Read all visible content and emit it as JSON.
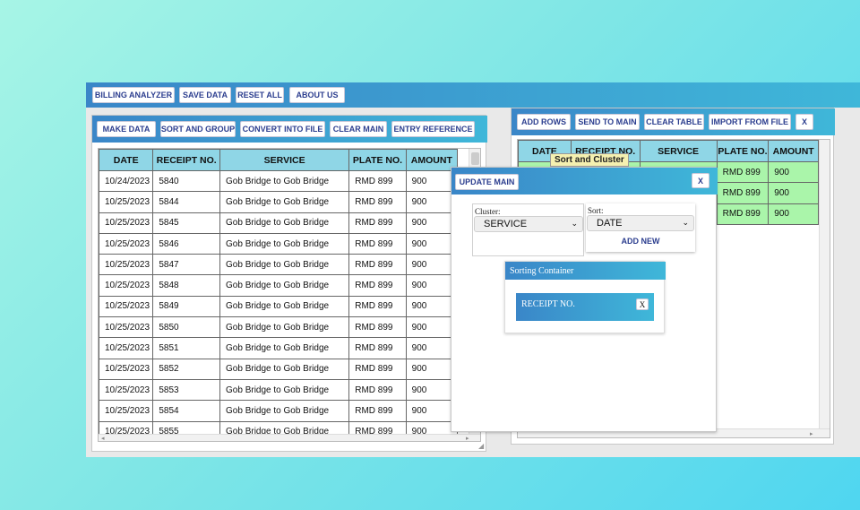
{
  "topbar": {
    "billing_analyzer": "BILLING ANALYZER",
    "save_data": "SAVE DATA",
    "reset_all": "RESET ALL",
    "about_us": "ABOUT US"
  },
  "main_toolbar": {
    "make_data": "MAKE DATA",
    "sort_and_group": "SORT AND GROUP",
    "convert_into_file": "CONVERT INTO FILE",
    "clear_main": "CLEAR MAIN",
    "entry_reference": "ENTRY REFERENCE"
  },
  "main_table": {
    "headers": [
      "DATE",
      "RECEIPT NO.",
      "SERVICE",
      "PLATE NO.",
      "AMOUNT"
    ],
    "rows": [
      [
        "10/24/2023",
        "5840",
        "Gob Bridge to Gob Bridge",
        "RMD 899",
        "900"
      ],
      [
        "10/25/2023",
        "5844",
        "Gob Bridge to Gob Bridge",
        "RMD 899",
        "900"
      ],
      [
        "10/25/2023",
        "5845",
        "Gob Bridge to Gob Bridge",
        "RMD 899",
        "900"
      ],
      [
        "10/25/2023",
        "5846",
        "Gob Bridge to Gob Bridge",
        "RMD 899",
        "900"
      ],
      [
        "10/25/2023",
        "5847",
        "Gob Bridge to Gob Bridge",
        "RMD 899",
        "900"
      ],
      [
        "10/25/2023",
        "5848",
        "Gob Bridge to Gob Bridge",
        "RMD 899",
        "900"
      ],
      [
        "10/25/2023",
        "5849",
        "Gob Bridge to Gob Bridge",
        "RMD 899",
        "900"
      ],
      [
        "10/25/2023",
        "5850",
        "Gob Bridge to Gob Bridge",
        "RMD 899",
        "900"
      ],
      [
        "10/25/2023",
        "5851",
        "Gob Bridge to Gob Bridge",
        "RMD 899",
        "900"
      ],
      [
        "10/25/2023",
        "5852",
        "Gob Bridge to Gob Bridge",
        "RMD 899",
        "900"
      ],
      [
        "10/25/2023",
        "5853",
        "Gob Bridge to Gob Bridge",
        "RMD 899",
        "900"
      ],
      [
        "10/25/2023",
        "5854",
        "Gob Bridge to Gob Bridge",
        "RMD 899",
        "900"
      ],
      [
        "10/25/2023",
        "5855",
        "Gob Bridge to Gob Bridge",
        "RMD 899",
        "900"
      ]
    ]
  },
  "second_toolbar": {
    "add_rows": "ADD ROWS",
    "send_to_main": "SEND TO MAIN",
    "clear_table": "CLEAR TABLE",
    "import_from_file": "IMPORT FROM FILE",
    "close": "X"
  },
  "second_table": {
    "headers": [
      "DATE",
      "RECEIPT NO.",
      "SERVICE",
      "PLATE NO.",
      "AMOUNT"
    ],
    "rows": [
      [
        "",
        "",
        "",
        "RMD 899",
        "900"
      ],
      [
        "",
        "",
        "",
        "RMD 899",
        "900"
      ],
      [
        "",
        "",
        "",
        "RMD 899",
        "900"
      ]
    ]
  },
  "tooltip": "Sort and Cluster",
  "sort_dialog": {
    "update_main": "UPDATE MAIN",
    "close": "X",
    "cluster_label": "Cluster:",
    "cluster_value": "SERVICE",
    "sort_label": "Sort:",
    "sort_value": "DATE",
    "add_new": "ADD NEW",
    "container_title": "Sorting Container",
    "item_label": "RECEIPT NO.",
    "item_remove": "X"
  },
  "colors": {
    "accent_gradient_start": "#3a86c8",
    "accent_gradient_end": "#3fb7d9",
    "header_cell": "#8fd6e6",
    "green_row": "#aaf5aa",
    "tooltip_bg": "#f5f0b0"
  },
  "icons": {
    "dropdown": "chevron-down-icon",
    "resize": "resize-grip-icon"
  }
}
